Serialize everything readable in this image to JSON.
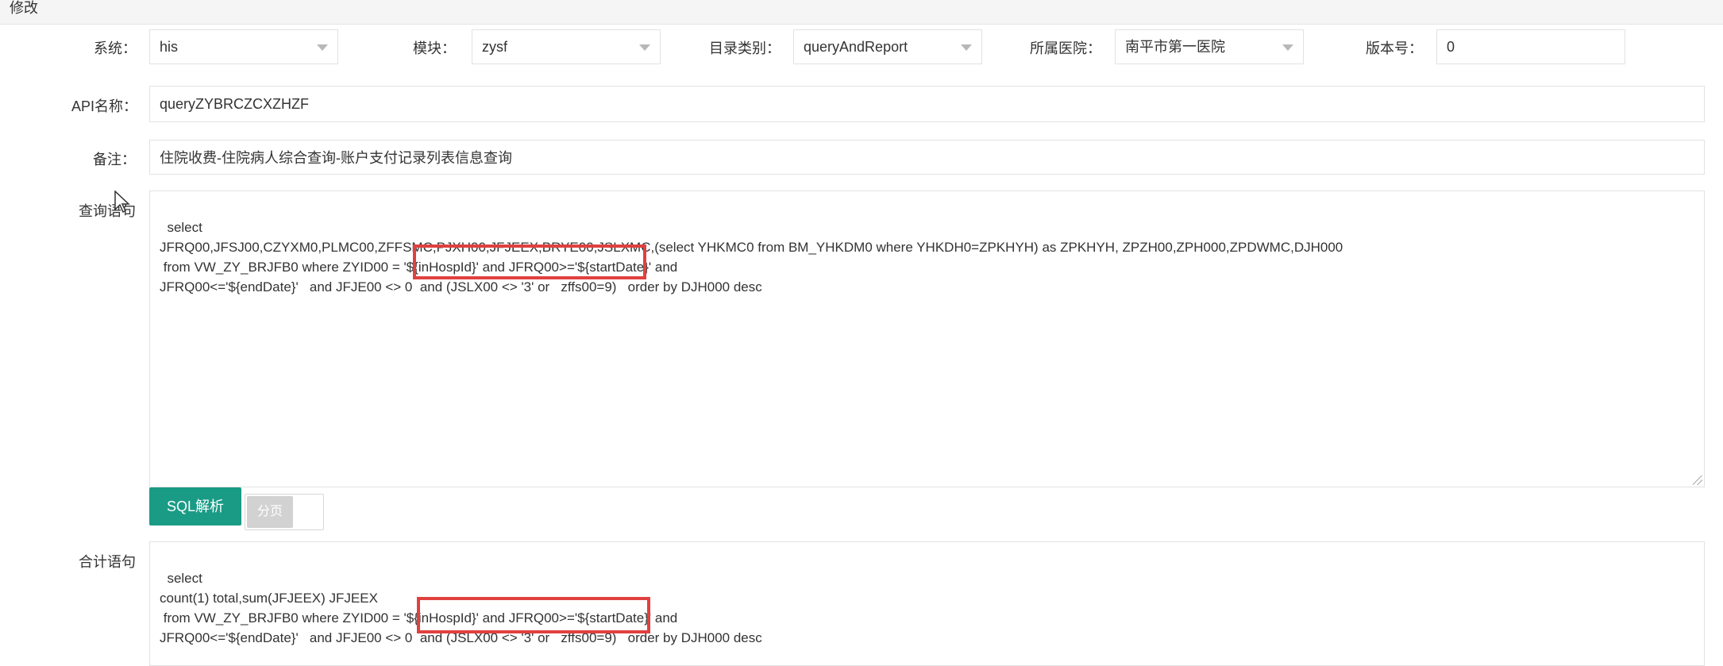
{
  "window": {
    "title": "修改"
  },
  "fields": {
    "system": {
      "label": "系统：",
      "value": "his"
    },
    "module": {
      "label": "模块：",
      "value": "zysf"
    },
    "catalog": {
      "label": "目录类别：",
      "value": "queryAndReport"
    },
    "hospital": {
      "label": "所属医院：",
      "value": "南平市第一医院"
    },
    "version": {
      "label": "版本号：",
      "value": "0"
    },
    "api_name": {
      "label": "API名称：",
      "value": "queryZYBRCZCXZHZF"
    },
    "remark": {
      "label": "备注：",
      "value": "住院收费-住院病人综合查询-账户支付记录列表信息查询"
    },
    "query": {
      "label": "查询语句",
      "value": "select\nJFRQ00,JFSJ00,CZYXM0,PLMC00,ZFFSMC,PJXH00,JFJEEX,BRYE00,JSLXMC,(select YHKMC0 from BM_YHKDM0 where YHKDH0=ZPKHYH) as ZPKHYH, ZPZH00,ZPH000,ZPDWMC,DJH000\n from VW_ZY_BRJFB0 where ZYID00 = '${inHospId}' and JFRQ00>='${startDate}' and\nJFRQ00<='${endDate}'   and JFJE00 <> 0  and (JSLX00 <> '3' or   zffs00=9)   order by DJH000 desc"
    },
    "total": {
      "label": "合计语句",
      "value": "select\ncount(1) total,sum(JFJEEX) JFJEEX\n from VW_ZY_BRJFB0 where ZYID00 = '${inHospId}' and JFRQ00>='${startDate}' and\nJFRQ00<='${endDate}'   and JFJE00 <> 0  and (JSLX00 <> '3' or   zffs00=9)   order by DJH000 desc"
    }
  },
  "buttons": {
    "sql_parse": "SQL解析",
    "paging": "分页"
  },
  "colors": {
    "primary": "#1a9b86",
    "highlight": "#e0413f"
  }
}
